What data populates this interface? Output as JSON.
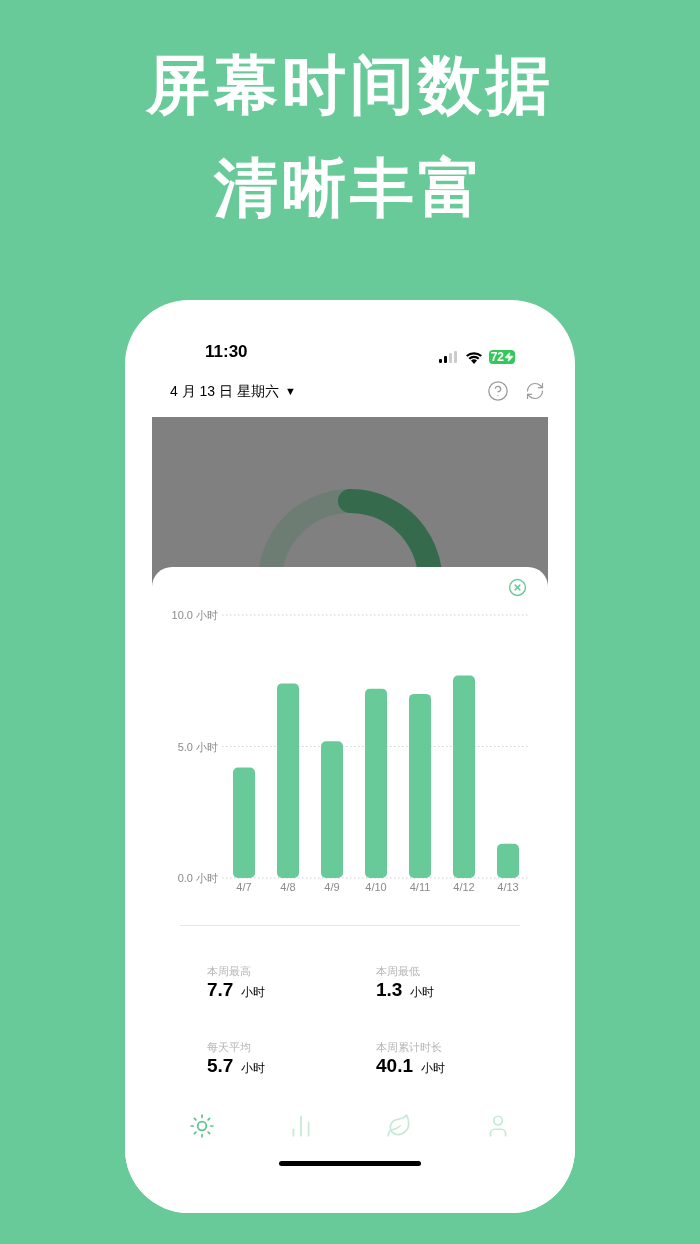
{
  "headline": [
    "屏幕时间数据",
    "清晰丰富"
  ],
  "status_bar": {
    "time": "11:30",
    "battery": "72"
  },
  "header": {
    "date": "4 月 13 日 星期六",
    "dropdown": "▼"
  },
  "chart_data": {
    "type": "bar",
    "categories": [
      "4/7",
      "4/8",
      "4/9",
      "4/10",
      "4/11",
      "4/12",
      "4/13"
    ],
    "values": [
      4.2,
      7.4,
      5.2,
      7.2,
      7.0,
      7.7,
      1.3
    ],
    "ylim": [
      0,
      10
    ],
    "yticks": [
      {
        "value": 0,
        "label": "0.0 小时"
      },
      {
        "value": 5,
        "label": "5.0 小时"
      },
      {
        "value": 10,
        "label": "10.0 小时"
      }
    ]
  },
  "stats": [
    {
      "label": "本周最高",
      "value": "7.7",
      "unit": "小时"
    },
    {
      "label": "本周最低",
      "value": "1.3",
      "unit": "小时"
    },
    {
      "label": "每天平均",
      "value": "5.7",
      "unit": "小时"
    },
    {
      "label": "本周累计时长",
      "value": "40.1",
      "unit": "小时"
    }
  ],
  "tab_bar": [
    {
      "kind": "sun",
      "selected": true
    },
    {
      "kind": "bars",
      "selected": false
    },
    {
      "kind": "leaf",
      "selected": false
    },
    {
      "kind": "user",
      "selected": false
    }
  ]
}
